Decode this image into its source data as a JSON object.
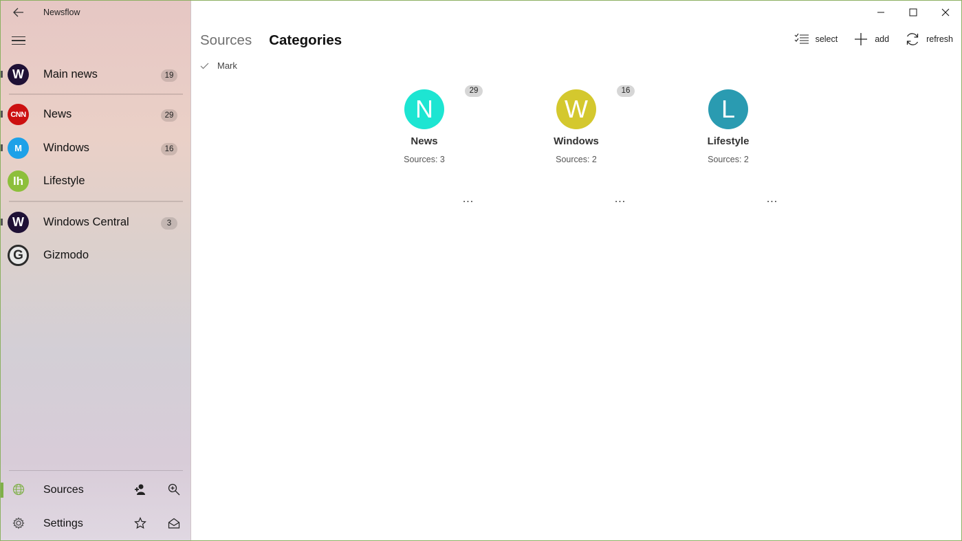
{
  "app": {
    "title": "Newsflow"
  },
  "sidebar": {
    "items": [
      {
        "label": "Main news",
        "count": "19",
        "avatar_letter": "W",
        "avatar_color": "#1f1136"
      },
      {
        "label": "News",
        "count": "29",
        "avatar_letter": "CNN",
        "avatar_color": "#cc1010"
      },
      {
        "label": "Windows",
        "count": "16",
        "avatar_letter": "M",
        "avatar_color": "#1da1e8"
      },
      {
        "label": "Lifestyle",
        "count": "",
        "avatar_letter": "lh",
        "avatar_color": "#8dbf3b"
      },
      {
        "label": "Windows Central",
        "count": "3",
        "avatar_letter": "W",
        "avatar_color": "#1f1136"
      },
      {
        "label": "Gizmodo",
        "count": "",
        "avatar_letter": "G",
        "avatar_color": "#2b2b2b"
      }
    ],
    "bottom": {
      "sources_label": "Sources",
      "settings_label": "Settings"
    }
  },
  "main": {
    "tabs": [
      {
        "label": "Sources",
        "active": false
      },
      {
        "label": "Categories",
        "active": true
      }
    ],
    "commands": {
      "select_label": "select",
      "add_label": "add",
      "refresh_label": "refresh"
    },
    "mark_label": "Mark",
    "categories": [
      {
        "letter": "N",
        "name": "News",
        "sources": "Sources:  3",
        "badge": "29",
        "color": "#1de5d2"
      },
      {
        "letter": "W",
        "name": "Windows",
        "sources": "Sources:  2",
        "badge": "16",
        "color": "#d4c82e"
      },
      {
        "letter": "L",
        "name": "Lifestyle",
        "sources": "Sources:  2",
        "badge": "",
        "color": "#2a9bb1"
      }
    ],
    "more_label": "..."
  },
  "colors": {
    "accent_green": "#7fb049",
    "window_border": "#8cb061"
  }
}
